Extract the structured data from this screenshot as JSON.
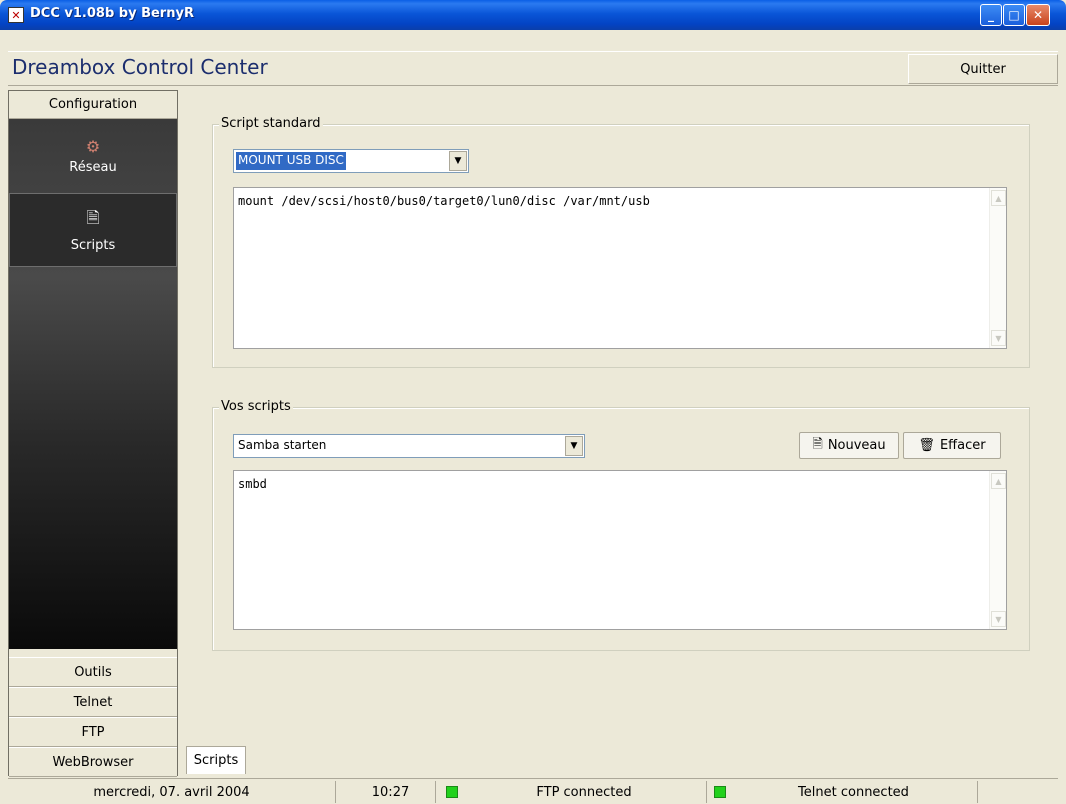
{
  "window": {
    "title": "DCC v1.08b by BernyR",
    "app_icon": "x-icon",
    "controls": {
      "minimize": "_",
      "maximize": "□",
      "close": "✕"
    }
  },
  "header": {
    "app_title": "Dreambox Control Center",
    "quit_label": "Quitter"
  },
  "sidebar": {
    "top_label": "Configuration",
    "items": [
      {
        "label": "Réseau",
        "icon": "network-icon",
        "glyph": "⚙"
      },
      {
        "label": "Scripts",
        "icon": "document-icon",
        "glyph": "🗎"
      }
    ],
    "bottom_items": [
      "Outils",
      "Telnet",
      "FTP",
      "WebBrowser"
    ]
  },
  "standard_script": {
    "legend": "Script standard",
    "selected": "MOUNT USB DISC",
    "content": "mount /dev/scsi/host0/bus0/target0/lun0/disc /var/mnt/usb"
  },
  "user_scripts": {
    "legend": "Vos scripts",
    "selected": "Samba starten",
    "new_label": "Nouveau",
    "delete_label": "Effacer",
    "content": "smbd"
  },
  "tabs": [
    "Scripts"
  ],
  "statusbar": {
    "date": "mercredi, 07. avril 2004",
    "time": "10:27",
    "ftp_status": "FTP connected",
    "telnet_status": "Telnet connected",
    "led_color": "#22d11c"
  }
}
